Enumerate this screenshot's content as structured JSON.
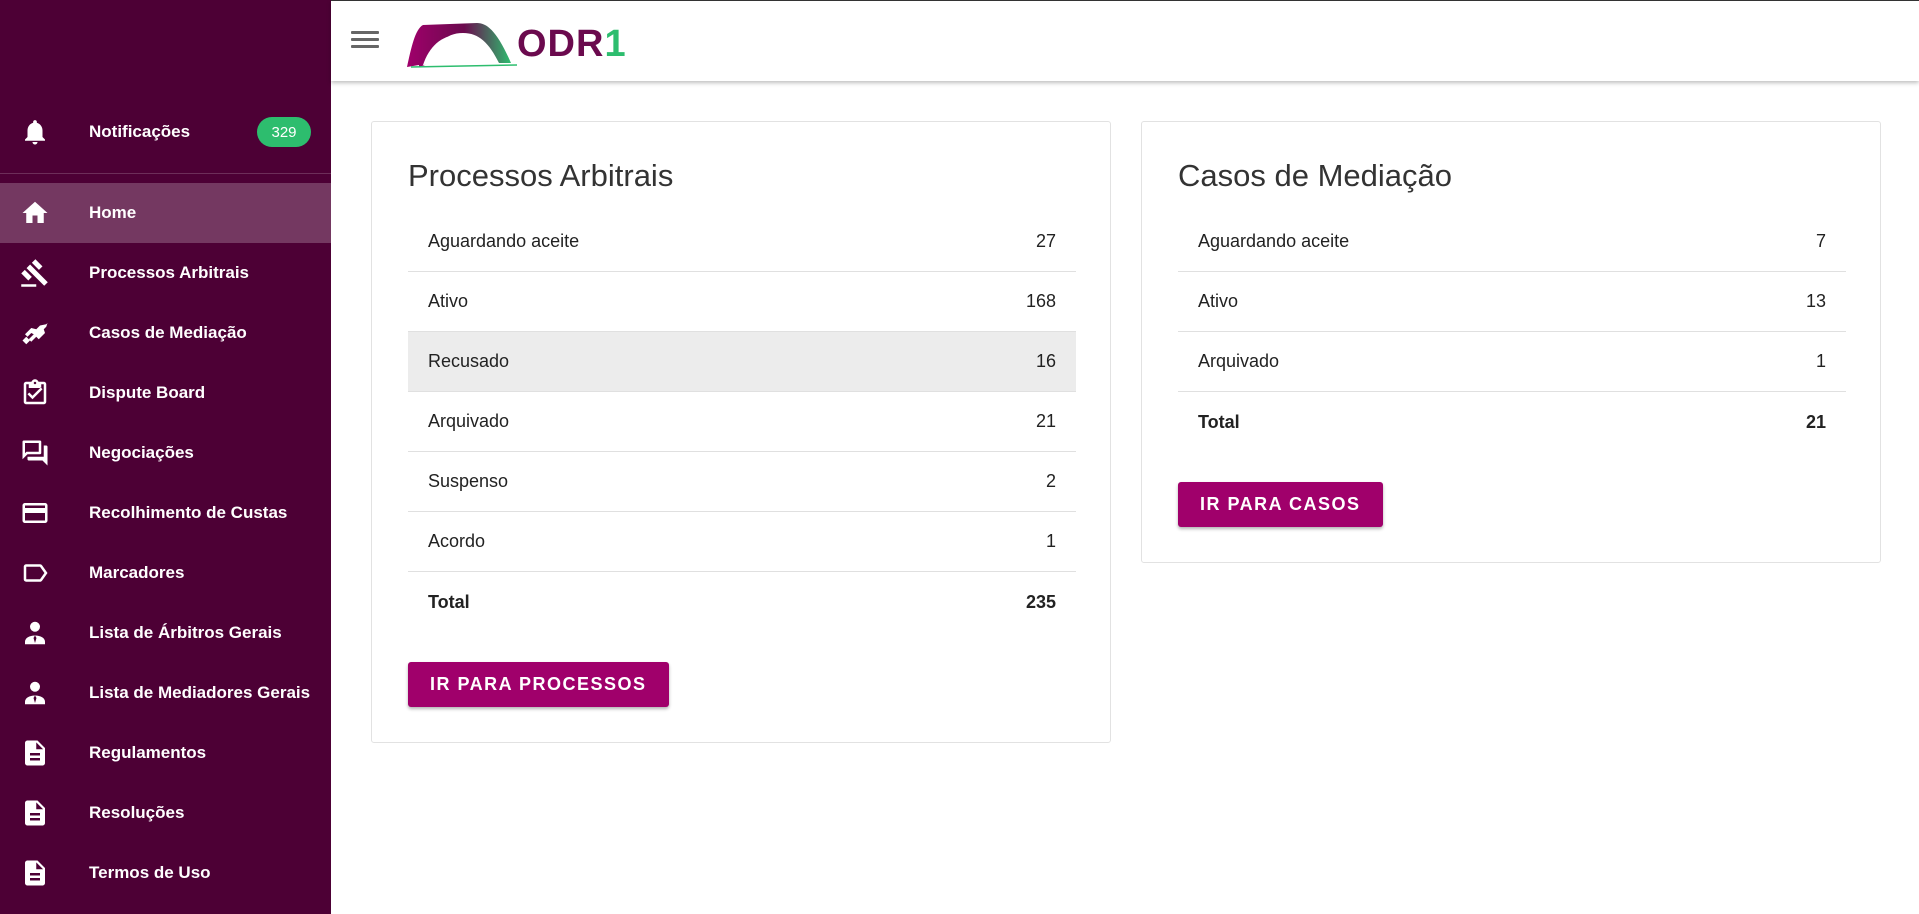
{
  "sidebar": {
    "notifications": {
      "label": "Notificações",
      "count": "329",
      "icon": "bell-icon"
    },
    "items": [
      {
        "label": "Home",
        "icon": "home-icon",
        "active": true
      },
      {
        "label": "Processos Arbitrais",
        "icon": "gavel-icon"
      },
      {
        "label": "Casos de Mediação",
        "icon": "handshake-icon"
      },
      {
        "label": "Dispute Board",
        "icon": "clipboard-check-icon"
      },
      {
        "label": "Negociações",
        "icon": "chat-icon"
      },
      {
        "label": "Recolhimento de Custas",
        "icon": "credit-card-icon"
      },
      {
        "label": "Marcadores",
        "icon": "label-icon"
      },
      {
        "label": "Lista de Árbitros Gerais",
        "icon": "person-tie-icon"
      },
      {
        "label": "Lista de Mediadores Gerais",
        "icon": "person-tie-icon"
      },
      {
        "label": "Regulamentos",
        "icon": "document-icon"
      },
      {
        "label": "Resoluções",
        "icon": "document-icon"
      },
      {
        "label": "Termos de Uso",
        "icon": "document-icon"
      }
    ]
  },
  "header": {
    "logo": {
      "text_main": "ODR",
      "text_accent": "1"
    }
  },
  "arbitral": {
    "title": "Processos Arbitrais",
    "rows": [
      {
        "label": "Aguardando aceite",
        "value": "27"
      },
      {
        "label": "Ativo",
        "value": "168"
      },
      {
        "label": "Recusado",
        "value": "16"
      },
      {
        "label": "Arquivado",
        "value": "21"
      },
      {
        "label": "Suspenso",
        "value": "2"
      },
      {
        "label": "Acordo",
        "value": "1"
      },
      {
        "label": "Total",
        "value": "235"
      }
    ],
    "button": "IR PARA PROCESSOS"
  },
  "mediation": {
    "title": "Casos de Mediação",
    "rows": [
      {
        "label": "Aguardando aceite",
        "value": "7"
      },
      {
        "label": "Ativo",
        "value": "13"
      },
      {
        "label": "Arquivado",
        "value": "1"
      },
      {
        "label": "Total",
        "value": "21"
      }
    ],
    "button": "IR PARA CASOS"
  },
  "colors": {
    "sidebar_bg": "#4d0035",
    "accent": "#a0006b",
    "badge": "#2dbd6e"
  }
}
